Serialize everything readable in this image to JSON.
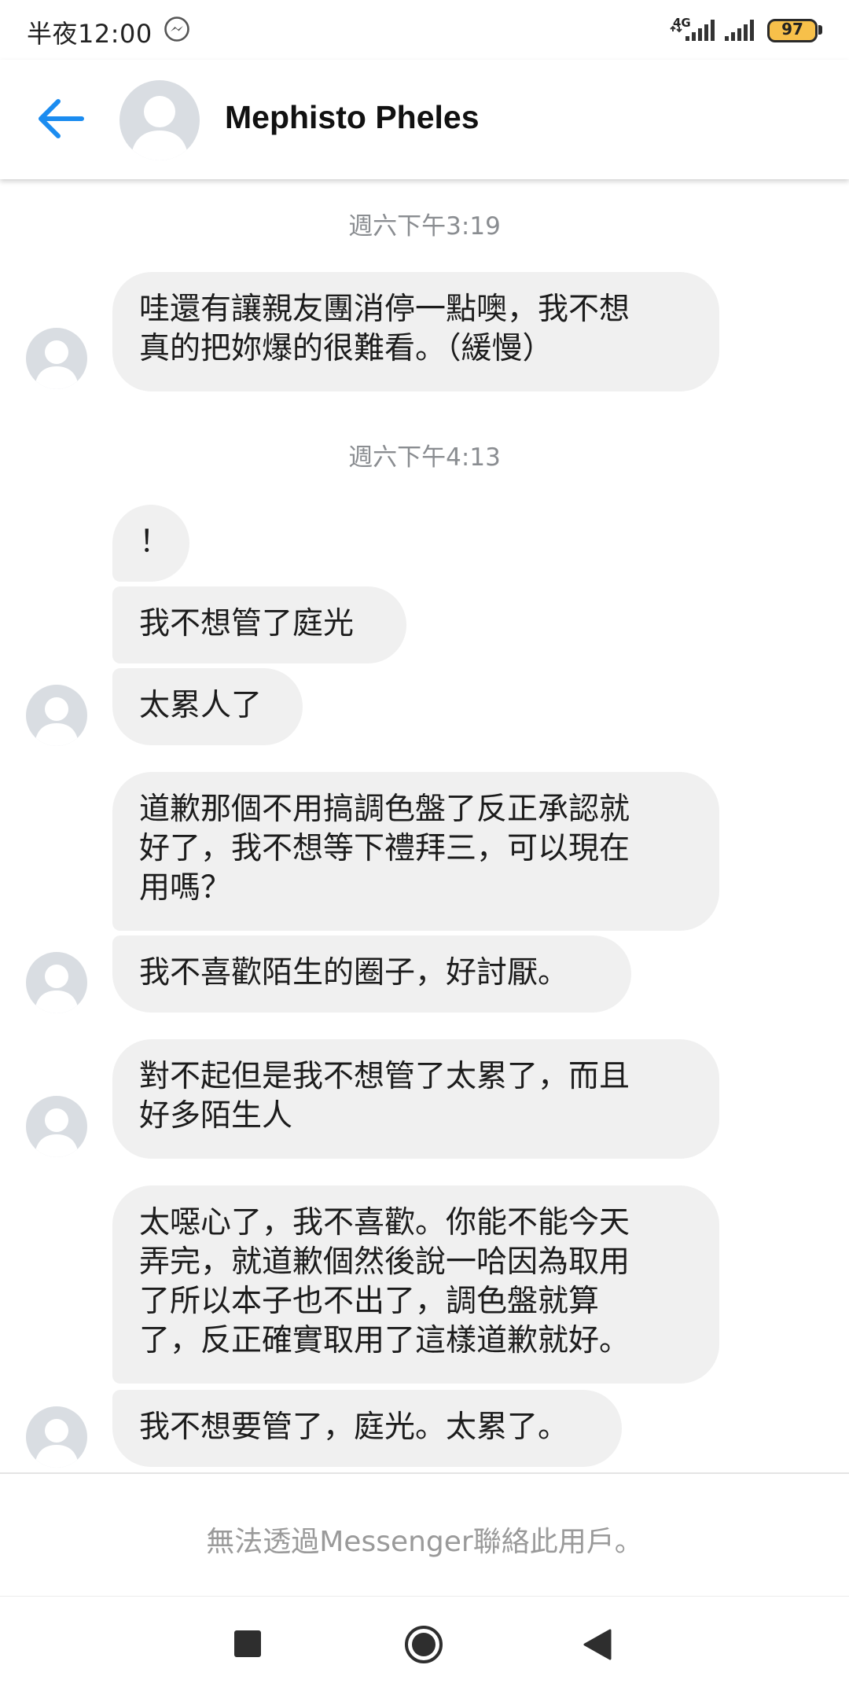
{
  "status_bar": {
    "time": "半夜12:00",
    "network": "4G",
    "battery": "97"
  },
  "header": {
    "contact_name": "Mephisto Pheles"
  },
  "conversation": {
    "timestamps": [
      "週六下午3:19",
      "週六下午4:13"
    ],
    "messages": [
      "哇還有讓親友團消停一點噢，我不想\n真的把妳爆的很難看。（緩慢）",
      "！",
      "我不想管了庭光",
      "太累人了",
      "道歉那個不用搞調色盤了反正承認就\n好了，我不想等下禮拜三，可以現在\n用嗎？",
      "我不喜歡陌生的圈子，好討厭。",
      "對不起但是我不想管了太累了，而且\n好多陌生人",
      "太噁心了，我不喜歡。你能不能今天\n弄完，就道歉個然後說一哈因為取用\n了所以本子也不出了，調色盤就算\n了，反正確實取用了這樣道歉就好。",
      "我不想要管了，庭光。太累了。"
    ]
  },
  "footer": {
    "notice": "無法透過Messenger聯絡此用戶。"
  },
  "colors": {
    "accent": "#1b8cf0",
    "bubble": "#f0f0f0",
    "timestamp": "#8a8d91",
    "avatar": "#d9dde2"
  },
  "icons": {
    "back": "back-arrow-icon",
    "messenger": "messenger-icon",
    "recents": "square-icon",
    "home": "home-circle-icon",
    "nav_back": "triangle-back-icon"
  }
}
